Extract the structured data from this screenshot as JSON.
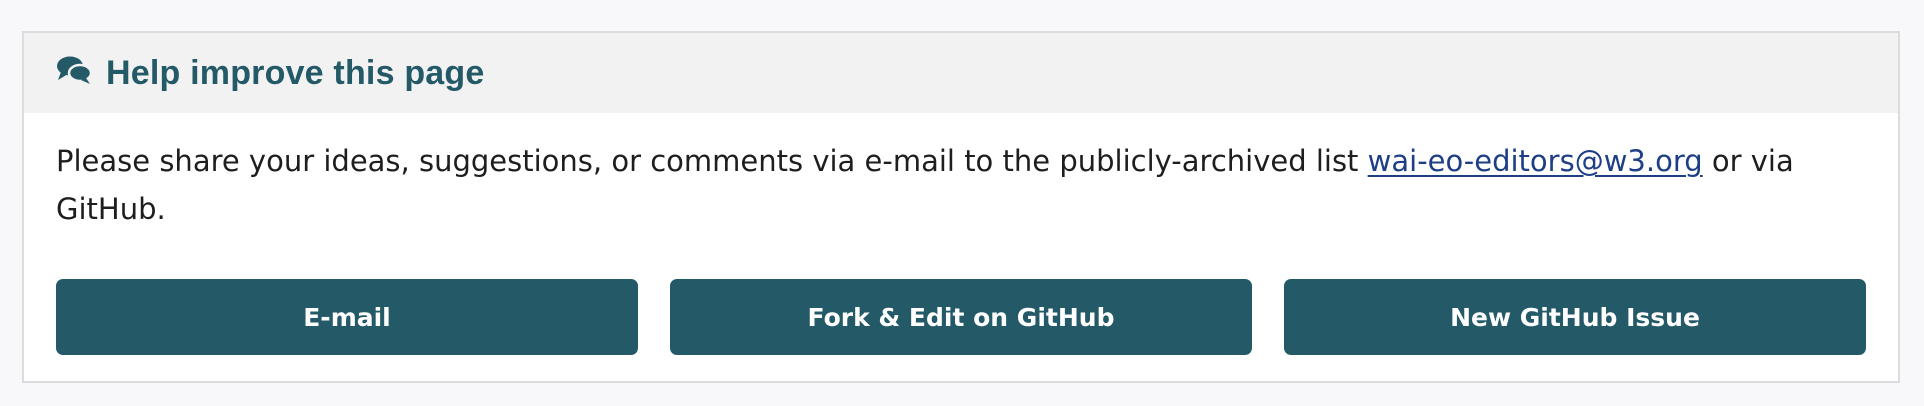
{
  "feedback": {
    "title": "Help improve this page",
    "icon": "comments-icon",
    "text_before": "Please share your ideas, suggestions, or comments via e-mail to the publicly-archived list ",
    "email_link": "wai-eo-editors@w3.org",
    "text_after": " or via GitHub.",
    "buttons": [
      {
        "label": "E-mail"
      },
      {
        "label": "Fork & Edit on GitHub"
      },
      {
        "label": "New GitHub Issue"
      }
    ]
  },
  "colors": {
    "accent": "#245a68",
    "link": "#1e3f86",
    "header_bg": "#f2f2f2",
    "page_bg": "#f8f8fa"
  }
}
